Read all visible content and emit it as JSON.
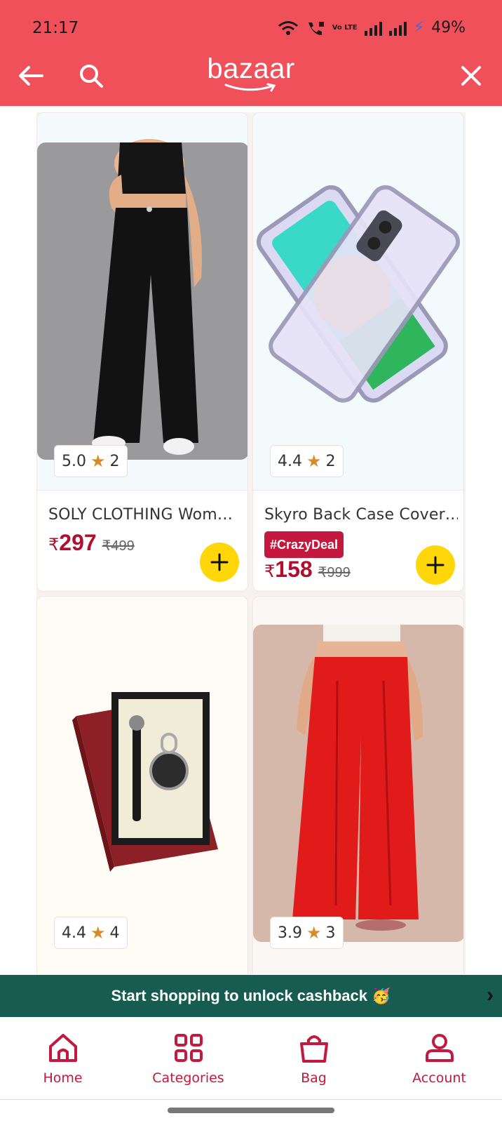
{
  "status_bar": {
    "time": "21:17",
    "volte": "Vo LTE",
    "battery": "49%"
  },
  "header": {
    "brand": "bazaar",
    "back_icon": "arrow-left-icon",
    "search_icon": "search-icon",
    "close_icon": "close-icon"
  },
  "products": [
    {
      "title": "SOLY CLOTHING Wom…",
      "rating": "5.0",
      "reviews": "2",
      "price": "297",
      "mrp": "₹499",
      "currency": "₹",
      "image": "black-trousers"
    },
    {
      "title": "Skyro Back Case Cover…",
      "rating": "4.4",
      "reviews": "2",
      "badge": "#CrazyDeal",
      "price": "158",
      "mrp": "₹999",
      "currency": "₹",
      "image": "transparent-phone-case"
    },
    {
      "rating": "4.4",
      "reviews": "4",
      "image": "pen-keychain-gift-set"
    },
    {
      "rating": "3.9",
      "reviews": "3",
      "image": "red-palazzo-pants"
    }
  ],
  "cashback": {
    "text": "Start shopping to unlock cashback 🥳"
  },
  "bottom_nav": [
    {
      "label": "Home",
      "icon": "home-icon"
    },
    {
      "label": "Categories",
      "icon": "categories-icon"
    },
    {
      "label": "Bag",
      "icon": "bag-icon"
    },
    {
      "label": "Account",
      "icon": "account-icon"
    }
  ],
  "colors": {
    "header": "#f0505a",
    "accent": "#c4183e",
    "price": "#b10f2e",
    "add_button": "#ffd60a",
    "cashback_bg": "#175c50"
  }
}
